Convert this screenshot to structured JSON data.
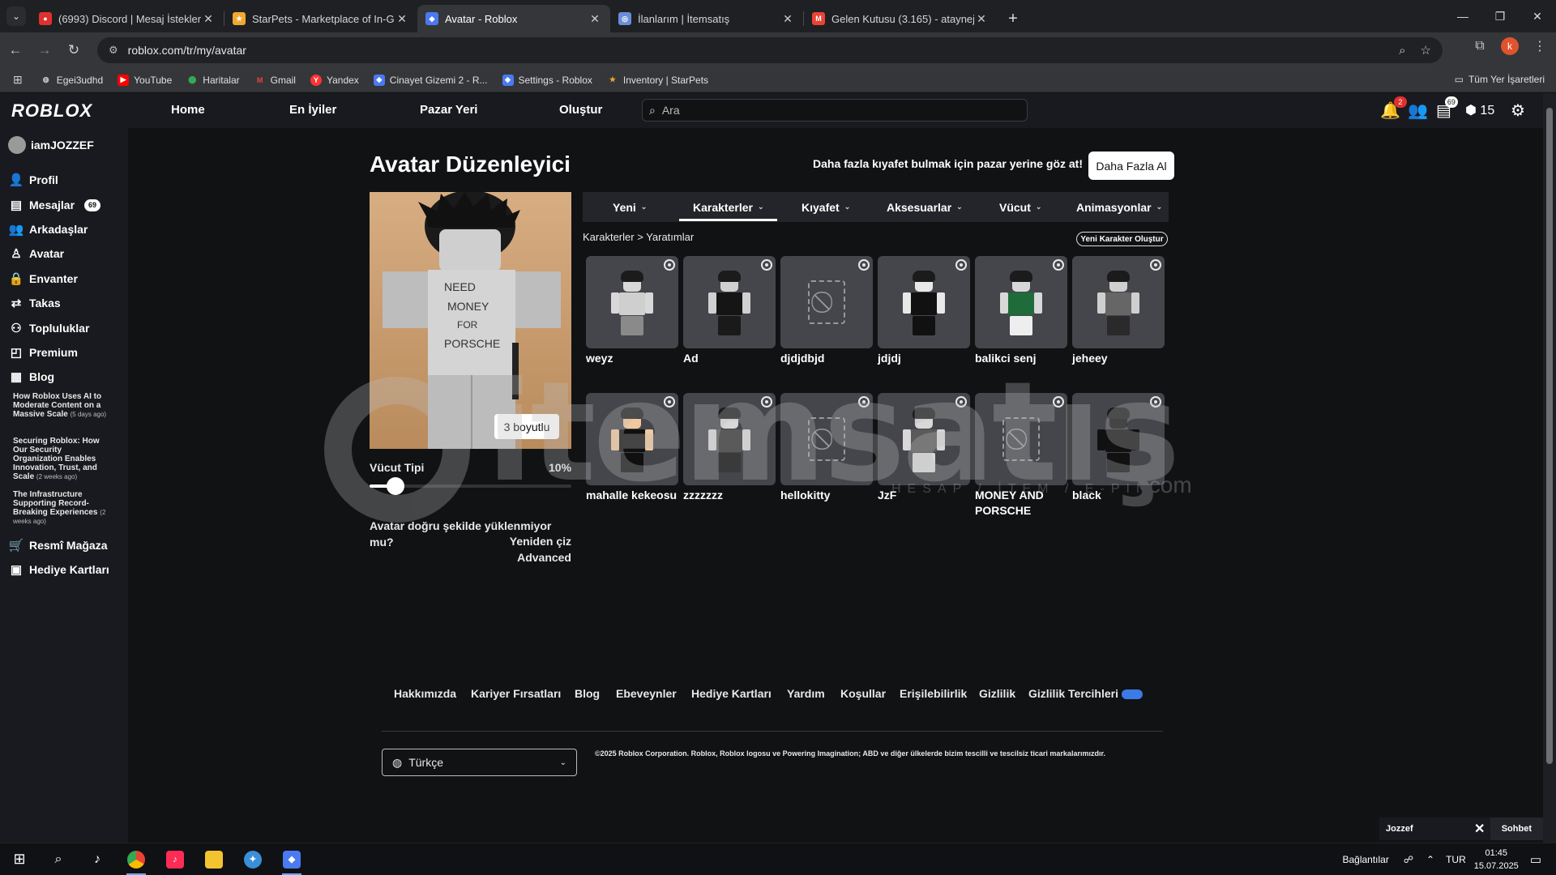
{
  "browser": {
    "tabs": [
      {
        "title": "(6993) Discord | Mesaj İstekleri",
        "icon": "discord-icon",
        "color": "#e0312f"
      },
      {
        "title": "StarPets - Marketplace of In-Game",
        "icon": "starpets-icon",
        "color": "#f0a830"
      },
      {
        "title": "Avatar - Roblox",
        "icon": "roblox-icon",
        "color": "#4a7af0"
      },
      {
        "title": "İlanlarım | İtemsatış",
        "icon": "itemsatis-icon",
        "color": "#6a8ed8"
      },
      {
        "title": "Gelen Kutusu (3.165) - ataynejd",
        "icon": "gmail-icon",
        "color": "#ea4335"
      }
    ],
    "url": "roblox.com/tr/my/avatar",
    "bookmarks": [
      {
        "label": "Egei3udhd",
        "icon": "globe-icon"
      },
      {
        "label": "YouTube",
        "icon": "youtube-icon"
      },
      {
        "label": "Haritalar",
        "icon": "maps-icon"
      },
      {
        "label": "Gmail",
        "icon": "gmail-icon"
      },
      {
        "label": "Yandex",
        "icon": "yandex-icon"
      },
      {
        "label": "Cinayet Gizemi 2 - R...",
        "icon": "roblox-icon"
      },
      {
        "label": "Settings - Roblox",
        "icon": "roblox-icon"
      },
      {
        "label": "Inventory | StarPets",
        "icon": "starpets-icon"
      }
    ],
    "all_bookmarks": "Tüm Yer İşaretleri",
    "profile_initial": "k"
  },
  "header": {
    "logo": "ROBLOX",
    "nav": [
      "Home",
      "En İyiler",
      "Pazar Yeri",
      "Oluştur"
    ],
    "search_placeholder": "Ara",
    "notif_count": "2",
    "chat_count": "69",
    "robux": "15"
  },
  "sidebar": {
    "username": "iamJOZZEF",
    "items": [
      {
        "label": "Profil",
        "icon": "person-icon"
      },
      {
        "label": "Mesajlar",
        "icon": "message-icon",
        "badge": "69"
      },
      {
        "label": "Arkadaşlar",
        "icon": "friends-icon"
      },
      {
        "label": "Avatar",
        "icon": "avatar-icon"
      },
      {
        "label": "Envanter",
        "icon": "inventory-icon"
      },
      {
        "label": "Takas",
        "icon": "trade-icon"
      },
      {
        "label": "Topluluklar",
        "icon": "groups-icon"
      },
      {
        "label": "Premium",
        "icon": "premium-icon"
      },
      {
        "label": "Blog",
        "icon": "blog-icon"
      }
    ],
    "blog_posts": [
      {
        "title": "How Roblox Uses AI to Moderate Content on a Massive Scale",
        "ago": "(5 days ago)"
      },
      {
        "title": "Securing Roblox: How Our Security Organization Enables Innovation, Trust, and Scale",
        "ago": "(2 weeks ago)"
      },
      {
        "title": "The Infrastructure Supporting Record-Breaking Experiences",
        "ago": "(2 weeks ago)"
      }
    ],
    "store": "Resmî Mağaza",
    "gift_cards": "Hediye Kartları"
  },
  "main": {
    "title": "Avatar Düzenleyici",
    "shop_text": "Daha fazla kıyafet bulmak için pazar yerine göz at!",
    "shop_button": "Daha Fazla Al",
    "btn_3d": "3 boyutlu",
    "body_type_label": "Vücut Tipi",
    "body_type_value": "10%",
    "body_type_fraction": 0.1,
    "not_loaded": "Avatar doğru şekilde yüklenmiyor mu?",
    "redraw": "Yeniden çiz",
    "advanced": "Advanced",
    "tabs": [
      "Yeni",
      "Karakterler",
      "Kıyafet",
      "Aksesuarlar",
      "Vücut",
      "Animasyonlar"
    ],
    "active_tab": "Karakterler",
    "breadcrumb": {
      "parent": "Karakterler",
      "sep": ">",
      "current": "Yaratımlar"
    },
    "new_character": "Yeni Karakter Oluştur",
    "characters": [
      {
        "name": "weyz",
        "torso": "#cfcfcf",
        "legs": "#8a8a8a",
        "skin": "#d8d8d8"
      },
      {
        "name": "Ad",
        "torso": "#151515",
        "legs": "#1a1a1a",
        "skin": "#d0d0d0"
      },
      {
        "name": "djdjdbjd",
        "noimg": true
      },
      {
        "name": "jdjdj",
        "torso": "#111111",
        "legs": "#111111",
        "skin": "#e8e8e8"
      },
      {
        "name": "balikci senj",
        "torso": "#1f6b3a",
        "legs": "#eeeeee",
        "skin": "#d8d8d8"
      },
      {
        "name": "jeheey",
        "torso": "#666666",
        "legs": "#2a2a2a",
        "skin": "#cfcfcf"
      },
      {
        "name": "mahalle kekeosu",
        "torso": "#101010",
        "legs": "#101010",
        "skin": "#f0c8a0"
      },
      {
        "name": "zzzzzzz",
        "torso": "#5a5a5a",
        "legs": "#3a3a3a",
        "skin": "#d8d8d8"
      },
      {
        "name": "hellokitty",
        "noimg": true
      },
      {
        "name": "JzF",
        "torso": "#5a5a5a",
        "legs": "#d8d8d8",
        "skin": "#d8d8d8"
      },
      {
        "name": "MONEY AND PORSCHE",
        "noimg": true
      },
      {
        "name": "black",
        "torso": "#111111",
        "legs": "#111111",
        "skin": "#111111"
      }
    ],
    "watermark": {
      "word": "itemsatış",
      "sub": "HESAP / İTEM / E-PIN",
      "com": ".com"
    }
  },
  "footer": {
    "links": [
      "Hakkımızda",
      "Kariyer Fırsatları",
      "Blog",
      "Ebeveynler",
      "Hediye Kartları",
      "Yardım",
      "Koşullar",
      "Erişilebilirlik",
      "Gizlilik",
      "Gizlilik Tercihleri"
    ],
    "language": "Türkçe",
    "copyright": "©2025 Roblox Corporation. Roblox, Roblox logosu ve Powering Imagination; ABD ve diğer ülkelerde bizim tescilli ve tescilsiz ticari markalarımızdır."
  },
  "chat": {
    "user": "Jozzef",
    "label": "Sohbet"
  },
  "taskbar": {
    "connections": "Bağlantılar",
    "lang": "TUR",
    "time": "01:45",
    "date": "15.07.2025"
  }
}
